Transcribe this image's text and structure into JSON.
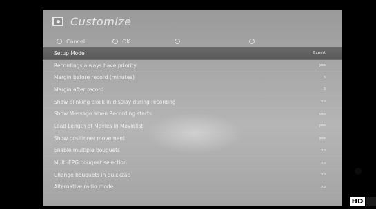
{
  "menu": {
    "title": "Customize",
    "icon": "settings-box-icon"
  },
  "buttons": [
    {
      "label": "Cancel",
      "icon": "circle-icon"
    },
    {
      "label": "OK",
      "icon": "circle-icon"
    },
    {
      "label": "",
      "icon": "circle-icon"
    },
    {
      "label": "",
      "icon": "circle-icon"
    }
  ],
  "settings": [
    {
      "label": "Setup Mode",
      "value": "Expert"
    },
    {
      "label": "Recordings always have priority",
      "value": "yes"
    },
    {
      "label": "Margin before record (minutes)",
      "value": "3"
    },
    {
      "label": "Margin after record",
      "value": "3"
    },
    {
      "label": "Show blinking clock in display during recording",
      "value": "no"
    },
    {
      "label": "Show Message when Recording starts",
      "value": "yes"
    },
    {
      "label": "Load Length of Movies in Movielist",
      "value": "yes"
    },
    {
      "label": "Show positioner movement",
      "value": "yes"
    },
    {
      "label": "Enable multiple bouquets",
      "value": "no"
    },
    {
      "label": "Multi-EPG bouquet selection",
      "value": "no"
    },
    {
      "label": "Change bouquets in quickzap",
      "value": "no"
    },
    {
      "label": "Alternative radio mode",
      "value": "no"
    }
  ],
  "selected_index": 0,
  "badge": {
    "label": "HD"
  }
}
